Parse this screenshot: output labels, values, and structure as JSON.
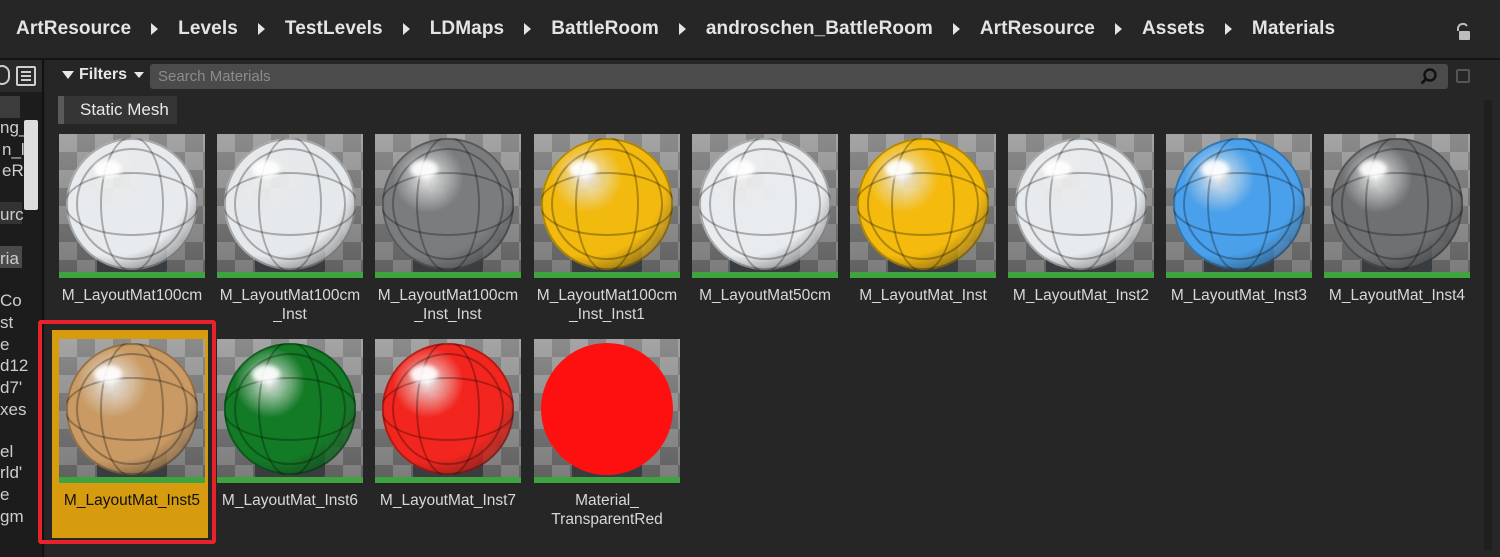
{
  "breadcrumb": [
    "ArtResource",
    "Levels",
    "TestLevels",
    "LDMaps",
    "BattleRoom",
    "androschen_BattleRoom",
    "ArtResource",
    "Assets",
    "Materials"
  ],
  "left_tree": {
    "rows": [
      "ng_",
      "n_l",
      "eR",
      "urc",
      "ria",
      "Co",
      "st",
      "e",
      "d12",
      "d7'",
      "xes",
      "el",
      "rld'",
      "e",
      "gm"
    ]
  },
  "toolbar": {
    "filters_label": "Filters",
    "search_placeholder": "Search Materials",
    "filter_chip": "Static Mesh"
  },
  "assets": [
    {
      "name": "M_LayoutMat100cm",
      "color": "#e8ebee"
    },
    {
      "name": "M_LayoutMat100cm _Inst",
      "color": "#e6e9ec"
    },
    {
      "name": "M_LayoutMat100cm _Inst_Inst",
      "color": "#7a7c7e"
    },
    {
      "name": "M_LayoutMat100cm _Inst_Inst1",
      "color": "#f2b90f"
    },
    {
      "name": "M_LayoutMat50cm",
      "color": "#e9ecef"
    },
    {
      "name": "M_LayoutMat_Inst",
      "color": "#f4ba0e"
    },
    {
      "name": "M_LayoutMat_Inst2",
      "color": "#e8ebee"
    },
    {
      "name": "M_LayoutMat_Inst3",
      "color": "#4aa0ea"
    },
    {
      "name": "M_LayoutMat_Inst4",
      "color": "#6e7072"
    },
    {
      "name": "M_LayoutMat_Inst5",
      "color": "#c99a64",
      "selected": true
    },
    {
      "name": "M_LayoutMat_Inst6",
      "color": "#137a26"
    },
    {
      "name": "M_LayoutMat_Inst7",
      "color": "#f2261e"
    },
    {
      "name": "Material_ TransparentRed",
      "color": "#ff1010"
    }
  ],
  "colors": {
    "selection_fill": "#d69b0e",
    "selection_outline": "#e8222b",
    "asset_bar": "#3fa33f"
  }
}
